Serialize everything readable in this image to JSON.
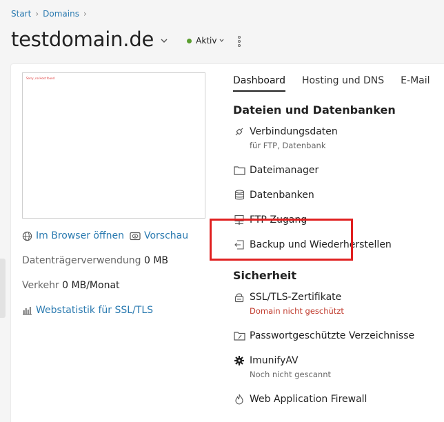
{
  "breadcrumb": {
    "start": "Start",
    "domains": "Domains"
  },
  "header": {
    "domain": "testdomain.de",
    "status": "Aktiv"
  },
  "preview": {
    "text": "Sorry, no Host found"
  },
  "left_panel": {
    "open_browser": "Im Browser öffnen",
    "preview": "Vorschau",
    "disk_label": "Datenträgerverwendung",
    "disk_value": "0 MB",
    "traffic_label": "Verkehr",
    "traffic_value": "0 MB/Monat",
    "webstats": "Webstatistik für SSL/TLS"
  },
  "tabs": [
    "Dashboard",
    "Hosting und DNS",
    "E-Mail"
  ],
  "files_section": {
    "title": "Dateien und Datenbanken",
    "items": [
      {
        "label": "Verbindungsdaten",
        "sub": "für FTP, Datenbank"
      },
      {
        "label": "Dateimanager"
      },
      {
        "label": "Datenbanken"
      },
      {
        "label": "FTP-Zugang"
      },
      {
        "label": "Backup und Wiederherstellen"
      }
    ]
  },
  "security_section": {
    "title": "Sicherheit",
    "items": [
      {
        "label": "SSL/TLS-Zertifikate",
        "sub": "Domain nicht geschützt"
      },
      {
        "label": "Passwortgeschützte Verzeichnisse"
      },
      {
        "label": "ImunifyAV",
        "sub": "Noch nicht gescannt"
      },
      {
        "label": "Web Application Firewall"
      }
    ]
  },
  "colors": {
    "link": "#2a7ab0",
    "status": "#5a9e2f",
    "warning": "#c0392b",
    "highlight": "#e02020"
  }
}
